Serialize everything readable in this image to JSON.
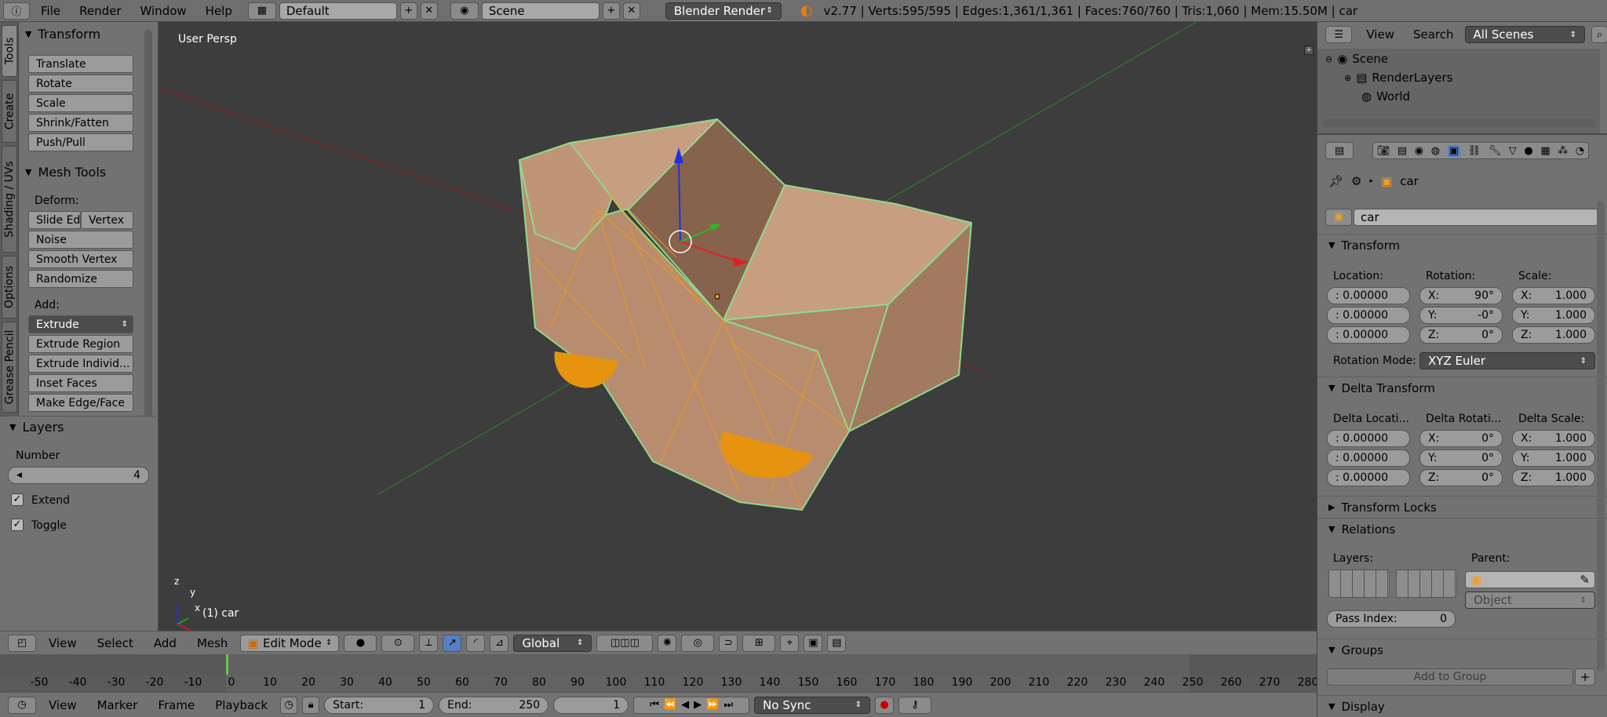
{
  "topbar": {
    "menus": [
      "File",
      "Render",
      "Window",
      "Help"
    ],
    "layout": "Default",
    "scene": "Scene",
    "engine": "Blender Render",
    "stats": "v2.77 | Verts:595/595 | Edges:1,361/1,361 | Faces:760/760 | Tris:1,060 | Mem:15.50M | car"
  },
  "tool_tabs": [
    "Tools",
    "Create",
    "Shading / UVs",
    "Options",
    "Grease Pencil"
  ],
  "tool_shelf": {
    "transform": {
      "title": "Transform",
      "buttons": [
        "Translate",
        "Rotate",
        "Scale",
        "Shrink/Fatten",
        "Push/Pull"
      ]
    },
    "mesh_tools": {
      "title": "Mesh Tools",
      "deform_label": "Deform:",
      "slide_edge": "Slide Ed",
      "vertex": "Vertex",
      "deform_buttons": [
        "Noise",
        "Smooth Vertex",
        "Randomize"
      ],
      "add_label": "Add:",
      "extrude": "Extrude",
      "add_buttons": [
        "Extrude Region",
        "Extrude Individ...",
        "Inset Faces",
        "Make Edge/Face"
      ]
    },
    "layers": {
      "title": "Layers",
      "number_label": "Number",
      "number_value": "4",
      "extend": "Extend",
      "toggle": "Toggle"
    }
  },
  "viewport": {
    "view_label": "User Persp",
    "object_label": "(1) car",
    "axis_x": "x",
    "axis_y": "y",
    "axis_z": "z"
  },
  "view_header": {
    "menus": [
      "View",
      "Select",
      "Add",
      "Mesh"
    ],
    "mode": "Edit Mode",
    "orientation": "Global"
  },
  "timeline": {
    "ticks": [
      "-50",
      "-40",
      "-30",
      "-20",
      "-10",
      "0",
      "10",
      "20",
      "30",
      "40",
      "50",
      "60",
      "70",
      "80",
      "90",
      "100",
      "110",
      "120",
      "130",
      "140",
      "150",
      "160",
      "170",
      "180",
      "190",
      "200",
      "210",
      "220",
      "230",
      "240",
      "250",
      "260",
      "270",
      "280"
    ],
    "current_frame": "1",
    "menus": [
      "View",
      "Marker",
      "Frame",
      "Playback"
    ],
    "start_label": "Start:",
    "start_value": "1",
    "end_label": "End:",
    "end_value": "250",
    "frame_value": "1",
    "sync": "No Sync"
  },
  "outliner": {
    "menus": [
      "View",
      "Search"
    ],
    "filter": "All Scenes",
    "items": [
      "Scene",
      "RenderLayers",
      "World"
    ]
  },
  "properties": {
    "breadcrumb": "car",
    "object_name": "car",
    "transform": {
      "title": "Transform",
      "location_label": "Location:",
      "rotation_label": "Rotation:",
      "scale_label": "Scale:",
      "location": [
        ": 0.00000",
        ": 0.00000",
        ": 0.00000"
      ],
      "rotation_axes": [
        "X:",
        "Y:",
        "Z:"
      ],
      "rotation": [
        "90°",
        "-0°",
        "0°"
      ],
      "scale_axes": [
        "X:",
        "Y:",
        "Z:"
      ],
      "scale": [
        "1.000",
        "1.000",
        "1.000"
      ],
      "rotation_mode_label": "Rotation Mode:",
      "rotation_mode": "XYZ Euler"
    },
    "delta": {
      "title": "Delta Transform",
      "location_label": "Delta Locati...",
      "rotation_label": "Delta Rotati...",
      "scale_label": "Delta Scale:",
      "location": [
        ": 0.00000",
        ": 0.00000",
        ": 0.00000"
      ],
      "rotation_axes": [
        "X:",
        "Y:",
        "Z:"
      ],
      "rotation": [
        "0°",
        "0°",
        "0°"
      ],
      "scale_axes": [
        "X:",
        "Y:",
        "Z:"
      ],
      "scale": [
        "1.000",
        "1.000",
        "1.000"
      ]
    },
    "transform_locks": "Transform Locks",
    "relations": {
      "title": "Relations",
      "layers_label": "Layers:",
      "parent_label": "Parent:",
      "parent_type": "Object",
      "pass_index_label": "Pass Index:",
      "pass_index": "0"
    },
    "groups": {
      "title": "Groups",
      "add_to_group": "Add to Group"
    },
    "display": "Display"
  },
  "colors": {
    "accent": "#5680c2",
    "select_orange": "#f39c12",
    "edge_green": "#8fd98f",
    "mesh_face": "#b88c6e"
  }
}
